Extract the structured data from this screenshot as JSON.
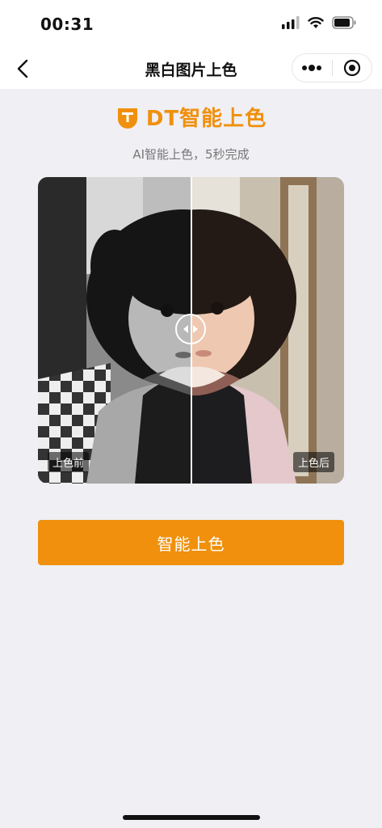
{
  "status_bar": {
    "time": "00:31"
  },
  "nav": {
    "title": "黑白图片上色"
  },
  "brand": {
    "name": "DT智能上色",
    "color": "#f0900c"
  },
  "subtitle": "AI智能上色，5秒完成",
  "compare": {
    "before_label": "上色前",
    "after_label": "上色后"
  },
  "action": {
    "label": "智能上色"
  },
  "icons": {
    "back": "chevron-left-icon",
    "more": "more-dots-icon",
    "close": "target-circle-icon",
    "signal": "signal-icon",
    "wifi": "wifi-icon",
    "battery": "battery-icon",
    "logo": "dt-logo-icon",
    "handle": "drag-arrows-icon"
  }
}
